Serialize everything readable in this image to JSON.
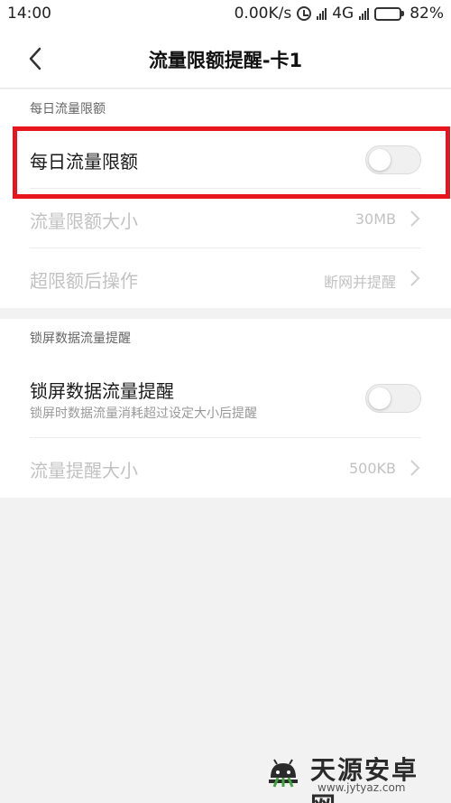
{
  "status_bar": {
    "time": "14:00",
    "speed": "0.00K/s",
    "network": "4G",
    "battery_pct": "82%",
    "battery_level": 0.82
  },
  "header": {
    "title": "流量限额提醒-卡1"
  },
  "section_daily": {
    "header": "每日流量限额",
    "rows": [
      {
        "label": "每日流量限额",
        "toggle": false
      },
      {
        "label": "流量限额大小",
        "value": "30MB"
      },
      {
        "label": "超限额后操作",
        "value": "断网并提醒"
      }
    ]
  },
  "section_lock": {
    "header": "锁屏数据流量提醒",
    "rows": [
      {
        "label": "锁屏数据流量提醒",
        "sub": "锁屏时数据流量消耗超过设定大小后提醒",
        "toggle": false
      },
      {
        "label": "流量提醒大小",
        "value": "500KB"
      }
    ]
  },
  "watermark": {
    "title": "天源安卓网",
    "url": "www.jytyaz.com"
  },
  "colors": {
    "highlight": "#e8141e",
    "background": "#f2f2f2"
  }
}
